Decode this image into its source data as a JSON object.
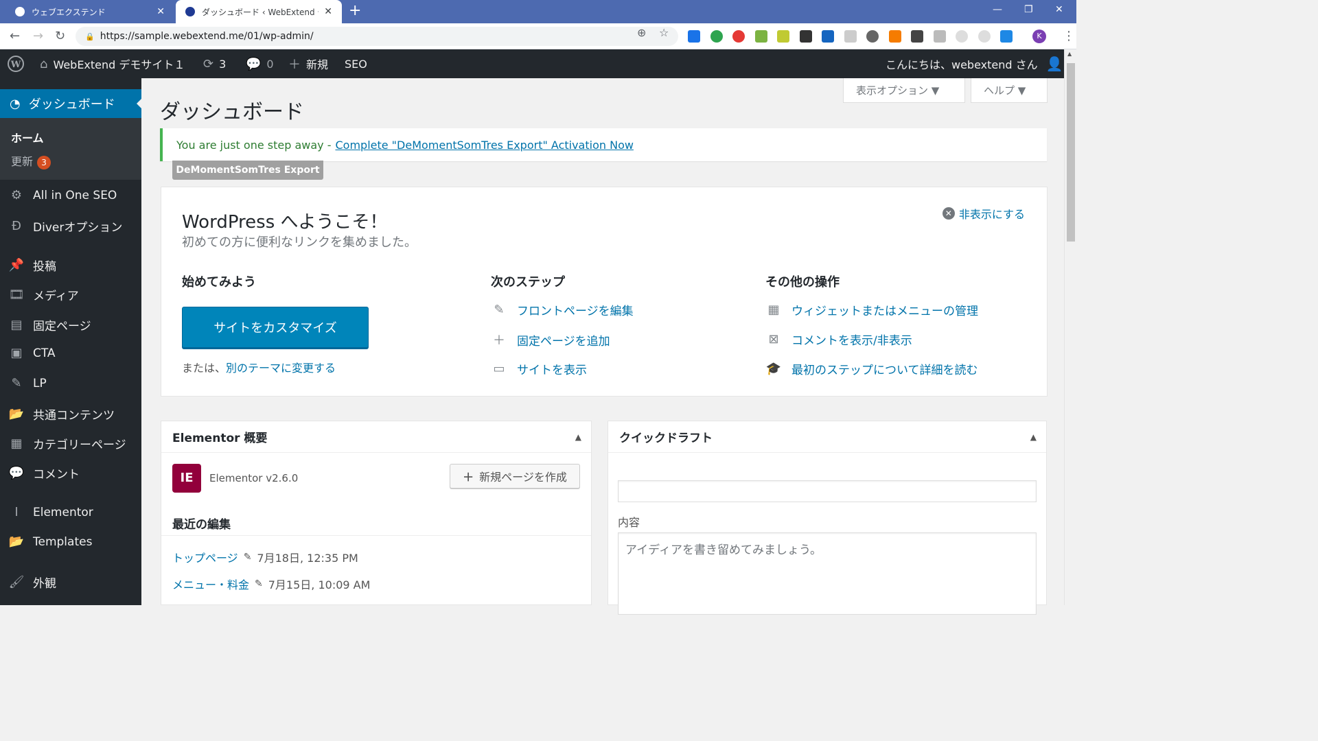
{
  "browser": {
    "tabs": [
      {
        "title": "ウェブエクステンド",
        "active": false
      },
      {
        "title": "ダッシュボード ‹ WebExtend デモサイ",
        "active": true
      }
    ],
    "url": "https://sample.webextend.me/01/wp-admin/",
    "profile_initial": "K"
  },
  "adminbar": {
    "site_name": "WebExtend デモサイト１",
    "updates_count": "3",
    "comments_count": "0",
    "new_label": "新規",
    "seo_label": "SEO",
    "greeting": "こんにちは、webextend さん"
  },
  "sidebar": {
    "dashboard": "ダッシュボード",
    "submenu": {
      "home": "ホーム",
      "updates": "更新",
      "updates_badge": "3"
    },
    "items": [
      {
        "label": "All in One SEO",
        "icon": "gear-icon"
      },
      {
        "label": "Diverオプション",
        "icon": "diver-icon"
      },
      {
        "label": "投稿",
        "icon": "pin-icon"
      },
      {
        "label": "メディア",
        "icon": "media-icon"
      },
      {
        "label": "固定ページ",
        "icon": "page-icon"
      },
      {
        "label": "CTA",
        "icon": "cta-icon"
      },
      {
        "label": "LP",
        "icon": "edit-icon"
      },
      {
        "label": "共通コンテンツ",
        "icon": "folder-icon"
      },
      {
        "label": "カテゴリーページ",
        "icon": "table-icon"
      },
      {
        "label": "コメント",
        "icon": "comment-icon"
      },
      {
        "label": "Elementor",
        "icon": "elementor-icon"
      },
      {
        "label": "Templates",
        "icon": "folder-icon"
      },
      {
        "label": "外観",
        "icon": "brush-icon"
      }
    ]
  },
  "screen_options": {
    "display": "表示オプション ▼",
    "help": "ヘルプ ▼"
  },
  "page_title": "ダッシュボード",
  "notice": {
    "lead": "You are just one step away -",
    "link": "Complete \"DeMomentSomTres Export\" Activation Now",
    "tag": "DeMomentSomTres Export"
  },
  "welcome": {
    "title": "WordPress へようこそ！",
    "about": "初めての方に便利なリンクを集めました。",
    "dismiss": "非表示にする",
    "col1_title": "始めてみよう",
    "customize_button": "サイトをカスタマイズ",
    "alt_prefix": "または、",
    "alt_link": "別のテーマに変更する",
    "col2_title": "次のステップ",
    "next_steps": [
      "フロントページを編集",
      "固定ページを追加",
      "サイトを表示"
    ],
    "col3_title": "その他の操作",
    "more_actions": [
      "ウィジェットまたはメニューの管理",
      "コメントを表示/非表示",
      "最初のステップについて詳細を読む"
    ]
  },
  "elementor_box": {
    "title": "Elementor 概要",
    "logo": "IE",
    "version": "Elementor v2.6.0",
    "new_page_button": "新規ページを作成",
    "recent_title": "最近の編集",
    "recent": [
      {
        "title": "トップページ",
        "date": "7月18日, 12:35 PM"
      },
      {
        "title": "メニュー・料金",
        "date": "7月15日, 10:09 AM"
      }
    ]
  },
  "quick_draft": {
    "title": "クイックドラフト",
    "content_label": "内容",
    "content_placeholder": "アイディアを書き留めてみましょう。"
  }
}
